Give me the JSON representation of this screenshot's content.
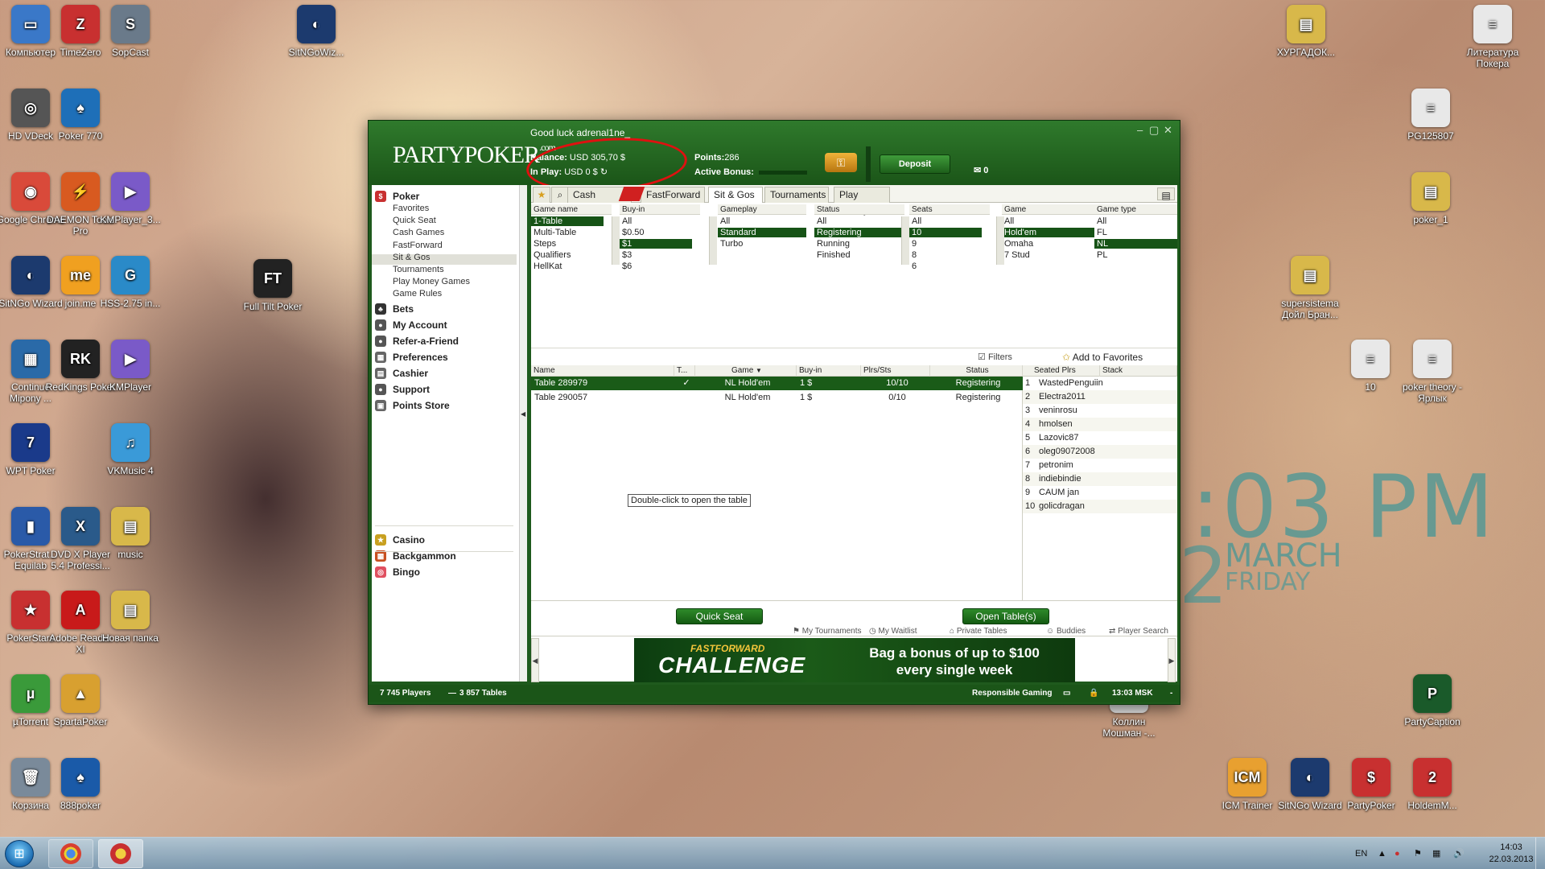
{
  "desktop_icons": [
    {
      "label": "Компьютер",
      "color": "#3a78c8",
      "glyph": "▭"
    },
    {
      "label": "TimeZero",
      "color": "#c83030",
      "glyph": "Z"
    },
    {
      "label": "SopCast",
      "color": "#6a7a8a",
      "glyph": "S"
    },
    {
      "label": "SitNGoWiz...",
      "color": "#1c3a6e",
      "glyph": "◐"
    },
    {
      "label": "HD VDeck",
      "color": "#555",
      "glyph": "◎"
    },
    {
      "label": "Poker 770",
      "color": "#1e6fb8",
      "glyph": "♠"
    },
    {
      "label": "Google Chrome",
      "color": "#d94a3a",
      "glyph": "◉"
    },
    {
      "label": "DAEMON Tools Pro",
      "color": "#d85a20",
      "glyph": "⚡"
    },
    {
      "label": "KMPlayer_3...",
      "color": "#7a5ac8",
      "glyph": "▶"
    },
    {
      "label": "SitNGo Wizard",
      "color": "#1c3a6e",
      "glyph": "◐"
    },
    {
      "label": "join.me",
      "color": "#f0a020",
      "glyph": "me"
    },
    {
      "label": "HSS-2.75 in...",
      "color": "#2a8ac8",
      "glyph": "G"
    },
    {
      "label": "Full Tilt Poker",
      "color": "#222",
      "glyph": "FT"
    },
    {
      "label": "Continue Mipony ...",
      "color": "#2a6aa8",
      "glyph": "▦"
    },
    {
      "label": "RedKings Poker",
      "color": "#222",
      "glyph": "RK"
    },
    {
      "label": "KMPlayer",
      "color": "#7a5ac8",
      "glyph": "▶"
    },
    {
      "label": "WPT Poker",
      "color": "#1a3a8a",
      "glyph": "7"
    },
    {
      "label": "VKMusic 4",
      "color": "#3a9ad8",
      "glyph": "♫"
    },
    {
      "label": "PokerStrat... Equilab",
      "color": "#2a5aa8",
      "glyph": "▮"
    },
    {
      "label": "DVD X Player 5.4 Professi...",
      "color": "#2a5a8a",
      "glyph": "X"
    },
    {
      "label": "music",
      "color": "#d8b84a",
      "glyph": "▤"
    },
    {
      "label": "PokerStars",
      "color": "#c83030",
      "glyph": "★"
    },
    {
      "label": "Adobe Reader XI",
      "color": "#c81a1a",
      "glyph": "A"
    },
    {
      "label": "Новая папка",
      "color": "#d8b84a",
      "glyph": "▤"
    },
    {
      "label": "µTorrent",
      "color": "#3a9a3a",
      "glyph": "µ"
    },
    {
      "label": "SpartaPoker",
      "color": "#d8a030",
      "glyph": "▲"
    },
    {
      "label": "Корзина",
      "color": "#7a8a9a",
      "glyph": "🗑"
    },
    {
      "label": "888poker",
      "color": "#1a5aa8",
      "glyph": "♠"
    },
    {
      "label": "ХУРГАДОК...",
      "color": "#d8b84a",
      "glyph": "▤"
    },
    {
      "label": "Литература Покера",
      "color": "#e8e8e8",
      "glyph": "≡"
    },
    {
      "label": "PG125807",
      "color": "#e8e8e8",
      "glyph": "≡"
    },
    {
      "label": "poker_1",
      "color": "#d8b84a",
      "glyph": "▤"
    },
    {
      "label": "supersistema Дойл Бран...",
      "color": "#d8b84a",
      "glyph": "▤"
    },
    {
      "label": "10",
      "color": "#e8e8e8",
      "glyph": "≡"
    },
    {
      "label": "poker theory - Ярлык",
      "color": "#e8e8e8",
      "glyph": "≡"
    },
    {
      "label": "Коллин Мошман -...",
      "color": "#e8e8e8",
      "glyph": "≡"
    },
    {
      "label": "PartyCaption",
      "color": "#1a5a2a",
      "glyph": "P"
    },
    {
      "label": "ICM Trainer",
      "color": "#e8a030",
      "glyph": "ICM"
    },
    {
      "label": "SitNGo Wizard",
      "color": "#1c3a6e",
      "glyph": "◐"
    },
    {
      "label": "PartyPoker",
      "color": "#c83030",
      "glyph": "$"
    },
    {
      "label": "HoldemM...",
      "color": "#c83030",
      "glyph": "2"
    }
  ],
  "clock_widget": {
    "time": ":03 PM",
    "day_number": "2",
    "month": "MARCH",
    "weekday": "FRIDAY"
  },
  "window": {
    "greeting": "Good luck adrenal1ne_",
    "logo": "PARTYPOKER",
    "logo_suffix": ".com",
    "balance_label": "Balance:",
    "balance_value": "USD 305,70 $",
    "inplay_label": "In Play:",
    "inplay_value": "USD 0 $",
    "points_label": "Points:",
    "points_value": "286",
    "active_bonus_label": "Active Bonus:",
    "deposit_label": "Deposit",
    "mail_count": "0",
    "controls": {
      "minimize": "–",
      "restore": "▢",
      "close": "✕"
    }
  },
  "nav": {
    "poker_head": "Poker",
    "poker_items": [
      "Favorites",
      "Quick Seat",
      "Cash Games",
      "FastForward",
      "Sit & Gos",
      "Tournaments",
      "Play Money Games",
      "Game Rules"
    ],
    "selected_item": "Sit & Gos",
    "other_heads": [
      "Bets",
      "My Account",
      "Refer-a-Friend",
      "Preferences",
      "Cashier",
      "Support",
      "Points Store"
    ],
    "games": [
      "Casino",
      "Backgammon",
      "Bingo"
    ]
  },
  "tabs": {
    "items": [
      "Cash Games",
      "FastForward",
      "Sit & Gos",
      "Tournaments",
      "Play Money"
    ],
    "active": "Sit & Gos",
    "star_icon": "star-icon",
    "search_icon": "search-icon"
  },
  "filters": {
    "game_name": {
      "header": "Game name",
      "options": [
        "1-Table",
        "Multi-Table",
        "Steps",
        "Qualifiers",
        "HellKat"
      ],
      "selected": "1-Table"
    },
    "buy_in": {
      "header": "Buy-in",
      "options": [
        "All",
        "$0.50",
        "$1",
        "$3",
        "$6"
      ],
      "selected": "$1"
    },
    "gameplay": {
      "header": "Gameplay",
      "options": [
        "All",
        "Standard",
        "Turbo"
      ],
      "selected": "Standard"
    },
    "status": {
      "header": "Status",
      "options": [
        "All",
        "Registering",
        "Running",
        "Finished"
      ],
      "selected": "Registering"
    },
    "seats": {
      "header": "Seats",
      "options": [
        "All",
        "10",
        "9",
        "8",
        "6"
      ],
      "selected": "10"
    },
    "game": {
      "header": "Game",
      "options": [
        "All",
        "Hold'em",
        "Omaha",
        "7 Stud"
      ],
      "selected": "Hold'em"
    },
    "game_type": {
      "header": "Game type",
      "options": [
        "All",
        "FL",
        "NL",
        "PL"
      ],
      "selected": "NL"
    },
    "filters_link": "Filters",
    "add_favorites": "Add to Favorites"
  },
  "table_list": {
    "headers": [
      "Name",
      "T...",
      "Game",
      "Buy-in",
      "Plrs/Sts",
      "Status"
    ],
    "rows": [
      {
        "name": "Table 289979",
        "t": "✓",
        "game": "NL Hold'em",
        "buyin": "1 $",
        "plrs": "10/10",
        "status": "Registering"
      },
      {
        "name": "Table 290057",
        "t": "",
        "game": "NL Hold'em",
        "buyin": "1 $",
        "plrs": "0/10",
        "status": "Registering"
      }
    ],
    "tooltip": "Double-click to open the table"
  },
  "seated": {
    "headers": [
      "Seated Plrs",
      "Stack"
    ],
    "players": [
      "WastedPenguiin",
      "Electra2011",
      "veninrosu",
      "hmolsen",
      "Lazovic87",
      "oleg09072008",
      "petronim",
      "indiebindie",
      "CAUM jan",
      "golicdragan"
    ]
  },
  "actions": {
    "quick_seat": "Quick Seat",
    "open_tables": "Open Table(s)",
    "links": [
      "My Tournaments",
      "My Waitlist",
      "Private Tables",
      "Buddies",
      "Player Search"
    ]
  },
  "banner": {
    "ff": "FASTFORWARD",
    "challenge": "CHALLENGE",
    "line1": "Bag a bonus of up to $100",
    "line2": "every single week"
  },
  "status_bar": {
    "players": "7 745 Players",
    "tables": "3 857 Tables",
    "responsible": "Responsible Gaming",
    "time": "13:03 MSK"
  },
  "taskbar": {
    "lang": "EN",
    "time": "14:03",
    "date": "22.03.2013"
  },
  "colors": {
    "party_green": "#1f5a1d",
    "selection": "#165316",
    "accent_red": "#e01010"
  }
}
